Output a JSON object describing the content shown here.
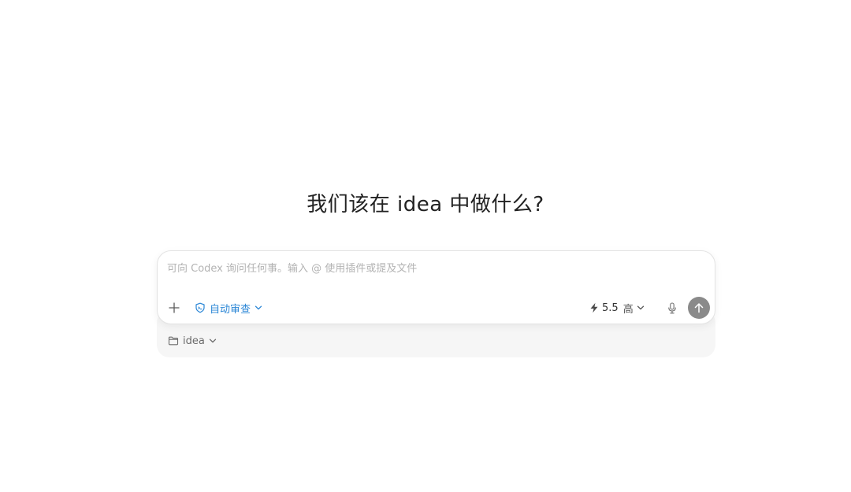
{
  "heading": "我们该在 idea 中做什么?",
  "composer": {
    "placeholder": "可向 Codex 询问任何事。输入 @ 使用插件或提及文件",
    "add_icon": "plus-icon",
    "review": {
      "label": "自动审查",
      "icon": "review-shield-icon",
      "color": "#2a86d6"
    },
    "model": {
      "icon": "lightning-icon",
      "version": "5.5",
      "level": "高"
    },
    "mic_icon": "microphone-icon",
    "send_icon": "arrow-up-icon"
  },
  "project": {
    "icon": "folder-icon",
    "name": "idea"
  }
}
